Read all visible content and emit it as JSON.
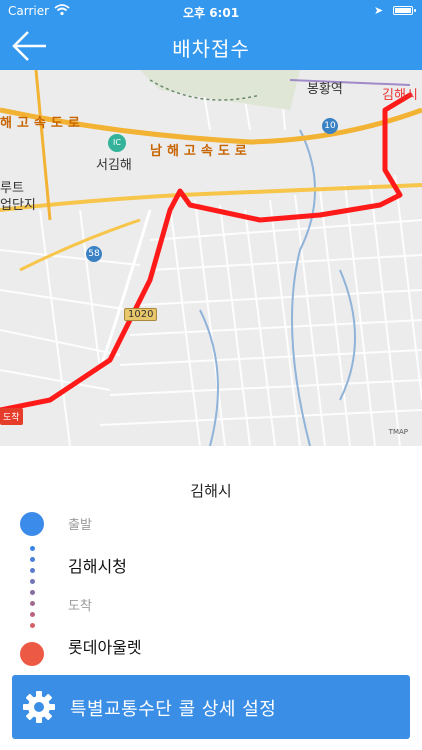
{
  "status": {
    "carrier": "Carrier",
    "time": "오후 6:01"
  },
  "navbar": {
    "title": "배차접수"
  },
  "map": {
    "labels": {
      "station": "봉황역",
      "gimhae_partial": "김해시",
      "highway": "남해고속도로",
      "highway_left": "해고속도로",
      "seogimhae": "서김해",
      "leftcut_1": "루트",
      "leftcut_2": "업단지",
      "route_58": "58",
      "route_1020": "1020",
      "route_10": "10",
      "ic": "IC",
      "arrive_marker": "도착",
      "brand": "TMAP"
    },
    "colors": {
      "route": "#ff1a1a",
      "highway": "#f2b233"
    }
  },
  "info": {
    "city": "김해시",
    "start_label": "출발",
    "start_place": "김해시청",
    "end_label": "도착",
    "end_place": "롯데아울렛"
  },
  "bottom": {
    "button_label": "특별교통수단 콜 상세 설정",
    "icon": "gear-icon"
  }
}
